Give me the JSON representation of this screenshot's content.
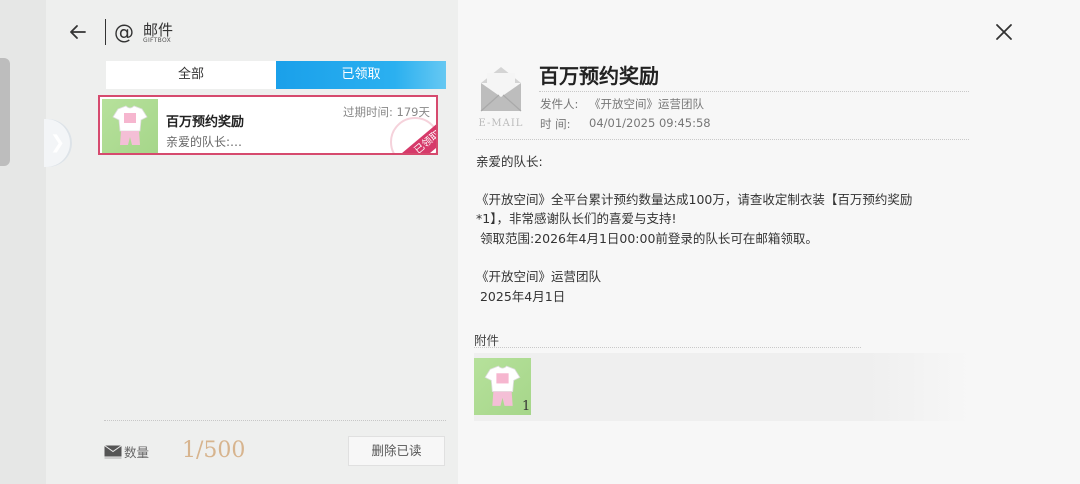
{
  "header": {
    "title": "邮件",
    "subtitle": "GIFTBOX",
    "icons": {
      "back": "back-arrow-icon",
      "at": "at-icon",
      "close": "close-icon"
    }
  },
  "tabs": [
    {
      "label": "全部",
      "active": false
    },
    {
      "label": "已领取",
      "active": true
    }
  ],
  "mail_list": [
    {
      "title": "百万预约奖励",
      "preview": "亲爱的队长:…",
      "expire": "过期时间: 179天",
      "stamp": "已领取",
      "thumbnail": "outfit-thumbnail"
    }
  ],
  "footer": {
    "count_label": "数量",
    "count_value": "1/500",
    "delete_label": "删除已读"
  },
  "detail": {
    "envelope_label": "E-MAIL",
    "title": "百万预约奖励",
    "sender_label": "发件人:",
    "sender": "《开放空间》运营团队",
    "time_label": "时  间:",
    "time": "04/01/2025 09:45:58",
    "body": [
      "亲爱的队长:",
      "",
      "《开放空间》全平台累计预约数量达成100万，请查收定制衣装【百万预约奖励",
      "*1】，非常感谢队长们的喜爱与支持!",
      " 领取范围:2026年4月1日00:00前登录的队长可在邮箱领取。",
      "",
      "《开放空间》运营团队",
      " 2025年4月1日"
    ],
    "attachment_label": "附件",
    "attachments": [
      {
        "quantity": "1",
        "thumbnail": "outfit-thumbnail"
      }
    ]
  },
  "colors": {
    "accent_blue": "#1aa0ea",
    "stamp_red": "#d63a6a",
    "count_gold": "#d7b48e",
    "thumb_green": "#a6d68a"
  }
}
